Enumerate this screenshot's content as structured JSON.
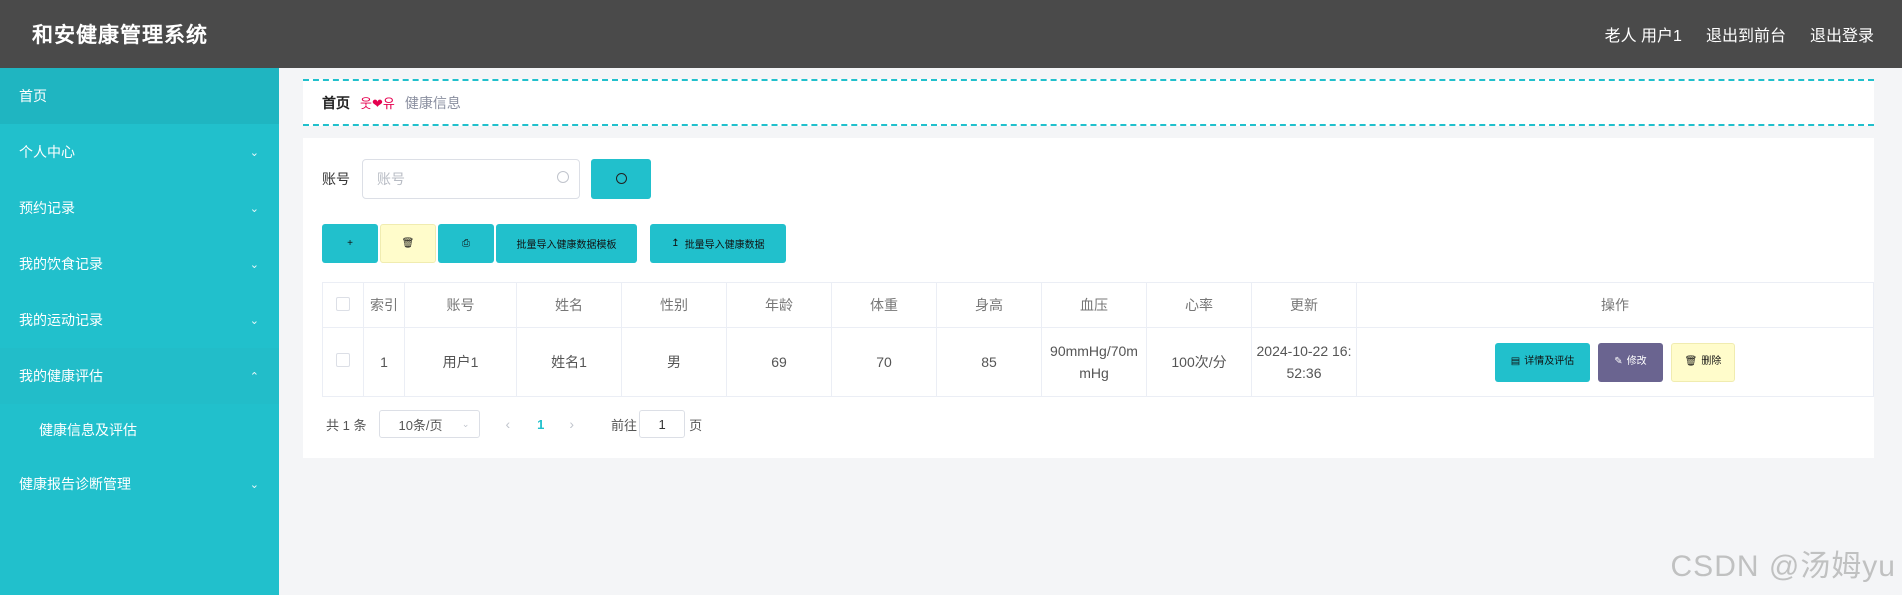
{
  "header": {
    "title": "和安健康管理系统",
    "links": [
      "老人 用户1",
      "退出到前台",
      "退出登录"
    ]
  },
  "sidebar": {
    "items": [
      {
        "label": "首页"
      },
      {
        "label": "个人中心"
      },
      {
        "label": "预约记录"
      },
      {
        "label": "我的饮食记录"
      },
      {
        "label": "我的运动记录"
      },
      {
        "label": "我的健康评估",
        "expanded": true,
        "sub": [
          "健康信息及评估"
        ]
      },
      {
        "label": "健康报告诊断管理"
      }
    ]
  },
  "breadcrumb": {
    "home": "首页",
    "separator": "웃❤유",
    "current": "健康信息"
  },
  "search": {
    "label": "账号",
    "placeholder": "账号"
  },
  "toolbar": {
    "template_label": "批量导入健康数据模板",
    "import_label": "批量导入健康数据"
  },
  "table": {
    "headers": [
      "索引",
      "账号",
      "姓名",
      "性别",
      "年龄",
      "体重",
      "身高",
      "血压",
      "心率",
      "更新",
      "操作"
    ],
    "rows": [
      {
        "index": "1",
        "account": "用户1",
        "name": "姓名1",
        "gender": "男",
        "age": "69",
        "weight": "70",
        "height": "85",
        "bp_line1": "90mmHg/70m",
        "bp_line2": "mHg",
        "heart_rate": "100次/分",
        "updated_line1": "2024-10-22 16:",
        "updated_line2": "52:36",
        "actions": {
          "detail": "详情及评估",
          "edit": "修改",
          "delete": "删除"
        }
      }
    ]
  },
  "pagination": {
    "total": "共 1 条",
    "page_size": "10条/页",
    "current_page": "1",
    "goto_label": "前往",
    "goto_value": "1",
    "page_suffix": "页"
  },
  "watermark": "CSDN @汤姆yu",
  "colors": {
    "accent": "#21c0cc",
    "header_bg": "#4a4a4a",
    "edit_button": "#6a6490",
    "soft_yellow": "#fffccb"
  }
}
